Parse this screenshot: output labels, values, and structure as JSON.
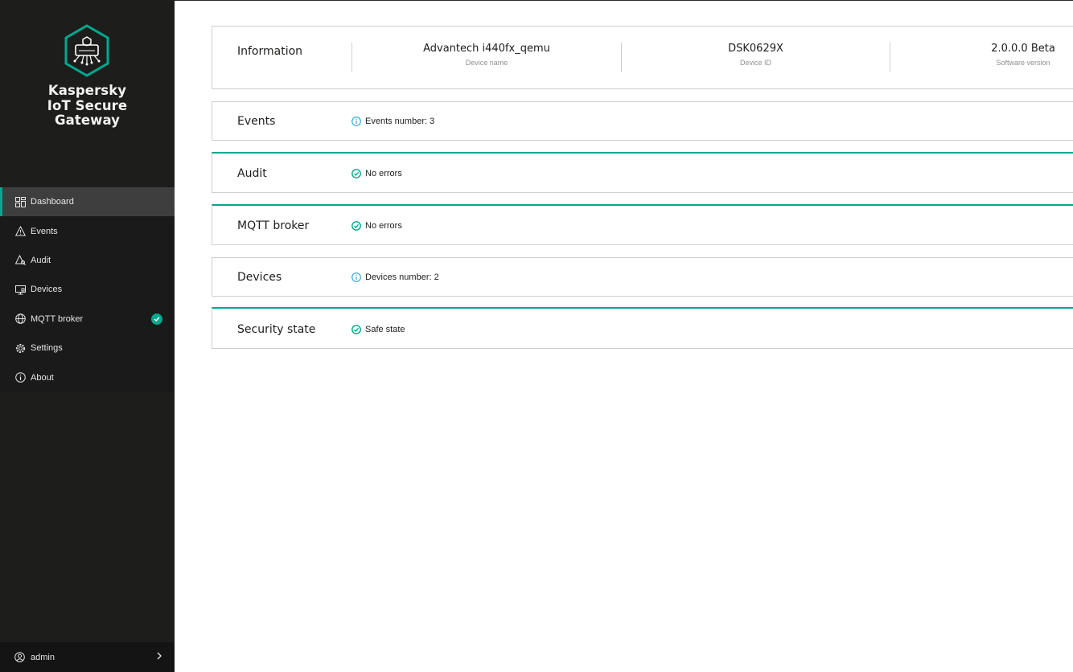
{
  "brand": {
    "line1": "Kaspersky",
    "line2": "IoT Secure",
    "line3": "Gateway",
    "accent": "#00a88e"
  },
  "nav": [
    {
      "label": "Dashboard",
      "icon": "dashboard-icon",
      "active": true
    },
    {
      "label": "Events",
      "icon": "warning-icon"
    },
    {
      "label": "Audit",
      "icon": "audit-icon"
    },
    {
      "label": "Devices",
      "icon": "devices-icon"
    },
    {
      "label": "MQTT broker",
      "icon": "globe-icon",
      "badge": "check-badge"
    },
    {
      "label": "Settings",
      "icon": "gear-icon"
    },
    {
      "label": "About",
      "icon": "info-icon"
    }
  ],
  "user": {
    "name": "admin",
    "icon": "user-icon"
  },
  "information": {
    "title": "Information",
    "device_name": {
      "value": "Advantech i440fx_qemu",
      "label": "Device name"
    },
    "device_id": {
      "value": "DSK0629X",
      "label": "Device ID"
    },
    "software_version": {
      "value": "2.0.0.0 Beta",
      "label": "Software version"
    }
  },
  "events": {
    "title": "Events",
    "status": "Events number: 3",
    "icon": "info-circle-icon"
  },
  "audit": {
    "title": "Audit",
    "status": "No errors",
    "icon": "check-circle-icon"
  },
  "mqtt": {
    "title": "MQTT broker",
    "status": "No errors",
    "icon": "check-circle-icon"
  },
  "devices": {
    "title": "Devices",
    "status": "Devices number: 2",
    "icon": "info-circle-icon"
  },
  "security": {
    "title": "Security state",
    "status": "Safe state",
    "icon": "check-circle-icon"
  }
}
